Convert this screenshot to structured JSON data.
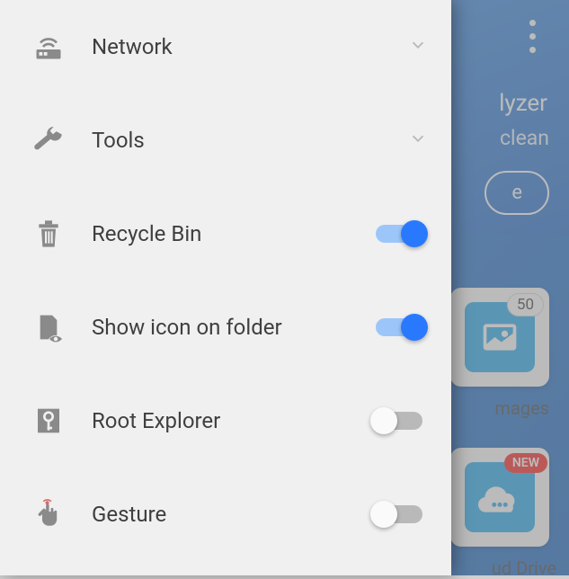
{
  "drawer": {
    "items": [
      {
        "id": "network",
        "label": "Network",
        "type": "expandable"
      },
      {
        "id": "tools",
        "label": "Tools",
        "type": "expandable"
      },
      {
        "id": "recycle-bin",
        "label": "Recycle Bin",
        "type": "toggle",
        "enabled": true
      },
      {
        "id": "show-icon",
        "label": "Show icon on folder",
        "type": "toggle",
        "enabled": true
      },
      {
        "id": "root-explorer",
        "label": "Root Explorer",
        "type": "toggle",
        "enabled": false
      },
      {
        "id": "gesture",
        "label": "Gesture",
        "type": "toggle",
        "enabled": false
      }
    ]
  },
  "background": {
    "title_fragment": "lyzer",
    "subtitle_fragment": "clean",
    "button_fragment": "e",
    "tiles": {
      "images": {
        "label": "mages",
        "badge": "50"
      },
      "cloud": {
        "label": "ud Drive",
        "badge_new": "NEW"
      }
    }
  }
}
